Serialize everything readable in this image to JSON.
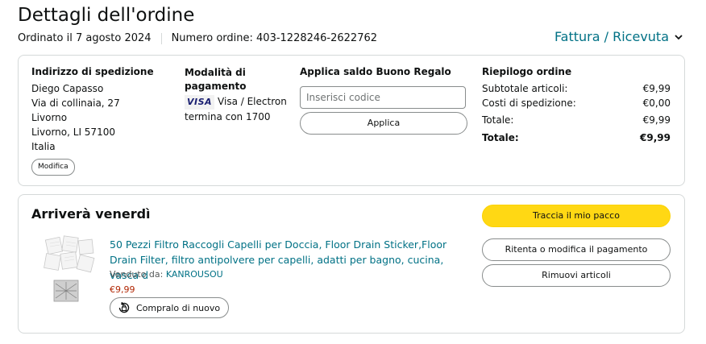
{
  "header": {
    "title": "Dettagli dell'ordine",
    "ordered_on": "Ordinato il 7 agosto 2024",
    "order_number": "Numero ordine: 403-1228246-2622762",
    "invoice_label": "Fattura / Ricevuta"
  },
  "shipping": {
    "heading": "Indirizzo di spedizione",
    "lines": [
      "Diego Capasso",
      "Via di collinaia, 27",
      "Livorno",
      "Livorno, LI 57100",
      "Italia"
    ],
    "edit_label": "Modifica"
  },
  "payment": {
    "heading": "Modalità di pagamento",
    "card_brand": "VISA",
    "card_name": "Visa / Electron",
    "card_ending": "termina con 1700"
  },
  "gift_card": {
    "heading": "Applica saldo Buono Regalo",
    "placeholder": "Inserisci codice",
    "apply_label": "Applica"
  },
  "summary": {
    "heading": "Riepilogo ordine",
    "rows": [
      {
        "label": "Subtotale articoli:",
        "value": "€9,99"
      },
      {
        "label": "Costi di spedizione:",
        "value": "€0,00"
      },
      {
        "label": "Totale:",
        "value": "€9,99"
      }
    ],
    "grand_total": {
      "label": "Totale:",
      "value": "€9,99"
    }
  },
  "shipment": {
    "arrival": "Arriverà venerdì",
    "track_label": "Traccia il mio pacco",
    "retry_payment_label": "Ritenta o modifica il pagamento",
    "remove_items_label": "Rimuovi articoli",
    "item": {
      "title": "50 Pezzi Filtro Raccogli Capelli per Doccia, Floor Drain Sticker,Floor Drain Filter, filtro antipolvere per capelli, adatti per bagno, cucina, vasca d",
      "sold_by_prefix": "Venduto da: ",
      "seller": "KANROUSOU",
      "price": "€9,99",
      "buy_again_label": "Compralo di nuovo"
    }
  },
  "colors": {
    "link": "#007185",
    "price": "#b12704",
    "primary_button": "#ffd814",
    "border": "#d5d9d9"
  },
  "icons": {
    "invoice_dropdown": "chevron-down-icon",
    "buy_again": "reorder-icon",
    "payment_card": "visa-logo-icon"
  }
}
